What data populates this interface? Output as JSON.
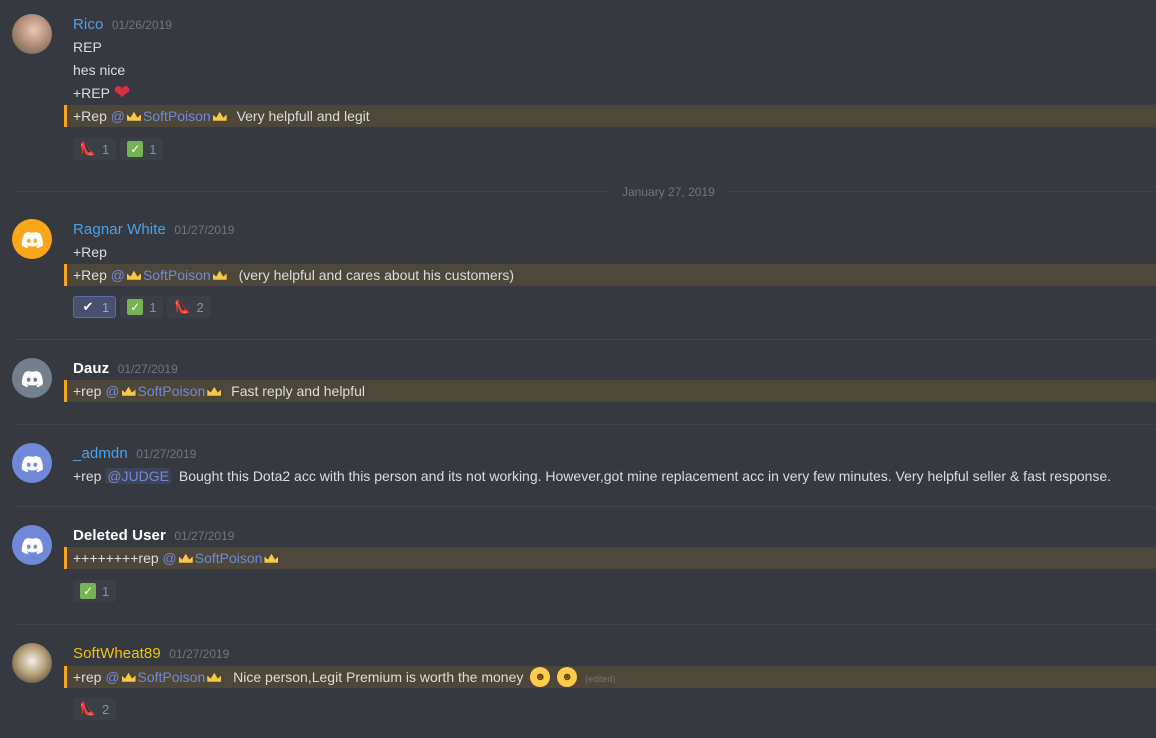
{
  "messages": [
    {
      "username": "Rico",
      "username_color": "#4aa3e8",
      "timestamp": "01/26/2019",
      "avatar": "user-photo-avatar",
      "lines": [
        "REP",
        "hes nice",
        "+REP"
      ],
      "mention_line": {
        "prefix": "+Rep",
        "mention": "@",
        "name": "SoftPoison",
        "text": "Very helpfull and legit"
      },
      "reactions": [
        {
          "icon": "shoe-icon",
          "count": "1"
        },
        {
          "icon": "check-green-icon",
          "count": "1"
        }
      ]
    },
    {
      "username": "Ragnar White",
      "username_color": "#4aa3e8",
      "timestamp": "01/27/2019",
      "avatar": "discord-orange-avatar",
      "lines": [
        "+Rep"
      ],
      "mention_line": {
        "prefix": "+Rep",
        "mention": "@",
        "name": "SoftPoison",
        "text": "(very helpful and cares about his customers)"
      },
      "reactions": [
        {
          "icon": "check-blue-icon",
          "count": "1"
        },
        {
          "icon": "check-green-icon",
          "count": "1"
        },
        {
          "icon": "shoe-icon",
          "count": "2"
        }
      ]
    },
    {
      "username": "Dauz",
      "username_color": "#ffffff",
      "timestamp": "01/27/2019",
      "avatar": "discord-grey-avatar",
      "mention_line": {
        "prefix": "+rep",
        "mention": "@",
        "name": "SoftPoison",
        "text": "Fast reply and helpful"
      }
    },
    {
      "username": "_admdn",
      "username_color": "#4aa3e8",
      "timestamp": "01/27/2019",
      "avatar": "discord-blurple-avatar",
      "line": {
        "prefix": "+rep",
        "mention": "@JUDGE",
        "text": "Bought this Dota2  acc with this person and its not working. However,got mine replacement acc in very few minutes. Very helpful seller & fast response."
      }
    },
    {
      "username": "Deleted User",
      "username_color": "#ffffff",
      "timestamp": "01/27/2019",
      "avatar": "discord-blurple-avatar",
      "mention_line": {
        "prefix": "++++++++rep",
        "mention": "@",
        "name": "SoftPoison",
        "text": ""
      },
      "reactions": [
        {
          "icon": "check-green-icon",
          "count": "1"
        }
      ]
    },
    {
      "username": "SoftWheat89",
      "username_color": "#f1c40f",
      "timestamp": "01/27/2019",
      "avatar": "user-photo-avatar",
      "mention_line": {
        "prefix": "+rep",
        "mention": "@",
        "name": "SoftPoison",
        "text": "Nice person,Legit Premium is worth the money",
        "edited": "(edited)"
      },
      "reactions": [
        {
          "icon": "shoe-icon",
          "count": "2"
        }
      ]
    }
  ],
  "date_divider": "January 27, 2019",
  "colors": {
    "background": "#36393f",
    "mention_highlight": "#faa61a",
    "mention_text": "#7289da"
  }
}
